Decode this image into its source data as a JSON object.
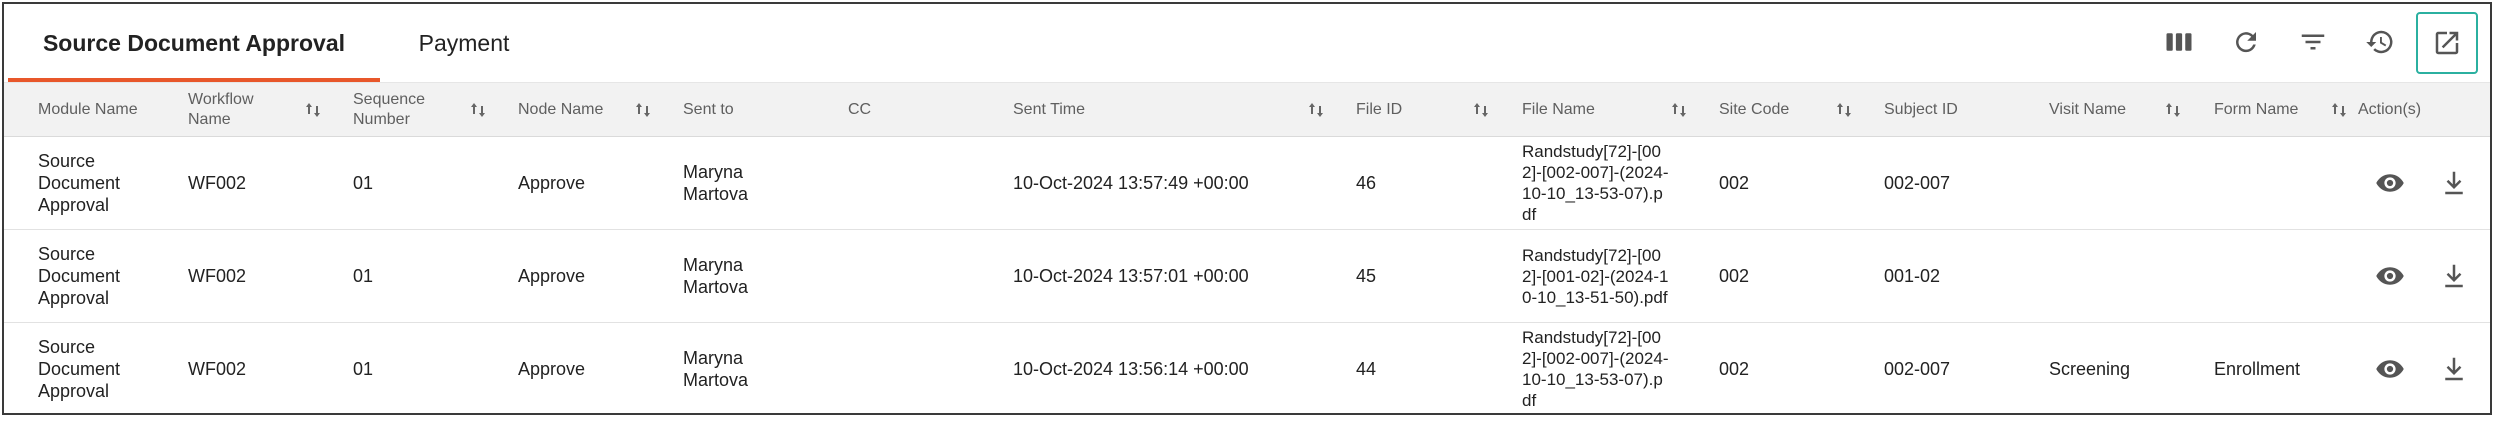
{
  "tabs": [
    {
      "label": "Source Document Approval",
      "active": true
    },
    {
      "label": "Payment",
      "active": false
    }
  ],
  "toolbar": {
    "icons": [
      "columns-icon",
      "refresh-icon",
      "filter-icon",
      "history-icon",
      "open-external-icon"
    ]
  },
  "colors": {
    "accent": "#e8572a",
    "focus": "#2bb0a0",
    "header_bg": "#f2f2f2"
  },
  "table": {
    "headers": {
      "module": "Module Name",
      "workflow": "Workflow Name",
      "sequence": "Sequence Number",
      "node": "Node Name",
      "sent_to": "Sent to",
      "cc": "CC",
      "sent_time": "Sent Time",
      "file_id": "File ID",
      "file_name": "File Name",
      "site_code": "Site Code",
      "subject_id": "Subject ID",
      "visit_name": "Visit Name",
      "form_name": "Form Name",
      "actions": "Action(s)"
    },
    "rows": [
      {
        "module": "Source Document Approval",
        "workflow": "WF002",
        "sequence": "01",
        "node": "Approve",
        "sent_to": "Maryna Martova",
        "cc": "",
        "sent_time": "10-Oct-2024 13:57:49 +00:00",
        "file_id": "46",
        "file_name": "Randstudy[72]-[002]-[002-007]-(2024-10-10_13-53-07).pdf",
        "site_code": "002",
        "subject_id": "002-007",
        "visit_name": "",
        "form_name": ""
      },
      {
        "module": "Source Document Approval",
        "workflow": "WF002",
        "sequence": "01",
        "node": "Approve",
        "sent_to": "Maryna Martova",
        "cc": "",
        "sent_time": "10-Oct-2024 13:57:01 +00:00",
        "file_id": "45",
        "file_name": "Randstudy[72]-[002]-[001-02]-(2024-10-10_13-51-50).pdf",
        "site_code": "002",
        "subject_id": "001-02",
        "visit_name": "",
        "form_name": ""
      },
      {
        "module": "Source Document Approval",
        "workflow": "WF002",
        "sequence": "01",
        "node": "Approve",
        "sent_to": "Maryna Martova",
        "cc": "",
        "sent_time": "10-Oct-2024 13:56:14 +00:00",
        "file_id": "44",
        "file_name": "Randstudy[72]-[002]-[002-007]-(2024-10-10_13-53-07).pdf",
        "site_code": "002",
        "subject_id": "002-007",
        "visit_name": "Screening",
        "form_name": "Enrollment"
      }
    ]
  }
}
